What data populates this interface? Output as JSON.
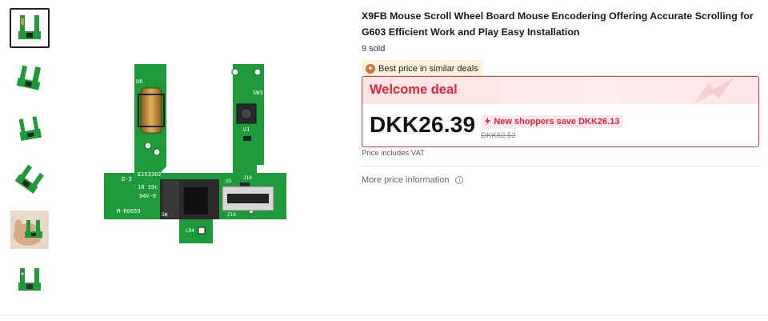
{
  "gallery": {
    "thumbnails": [
      {
        "name": "board-front",
        "active": true
      },
      {
        "name": "board-angle-1",
        "active": false
      },
      {
        "name": "board-angle-2",
        "active": false
      },
      {
        "name": "board-angle-3",
        "active": false
      },
      {
        "name": "board-in-hand",
        "active": false
      },
      {
        "name": "board-back",
        "active": false
      }
    ]
  },
  "product": {
    "title": "X9FB Mouse Scroll Wheel Board Mouse Encodering Offering Accurate Scrolling for G603 Efficient Work and Play Easy Installation",
    "sold": "9 sold",
    "badge": "Best price in similar deals",
    "pcb_labels": {
      "u6": "U6",
      "sw3": "SW3",
      "u1": "U1",
      "d3": "D-3",
      "code": "E153302",
      "date": "18 19c",
      "rating": "94V-0",
      "model": "M-R0059",
      "u3": "U3",
      "j10": "J10",
      "sw": "SW",
      "z10": "Z10",
      "ld4": "LD4"
    }
  },
  "deal": {
    "title": "Welcome deal",
    "price": "DKK26.39",
    "save_text": "New shoppers save DKK26.13",
    "original_price": "DKK52.52"
  },
  "price_note": "Price includes VAT",
  "more_info": "More price information",
  "colors": {
    "accent_red": "#e8233b",
    "pcb_green": "#1f9a3a",
    "badge_bg": "#fdf1dc"
  }
}
